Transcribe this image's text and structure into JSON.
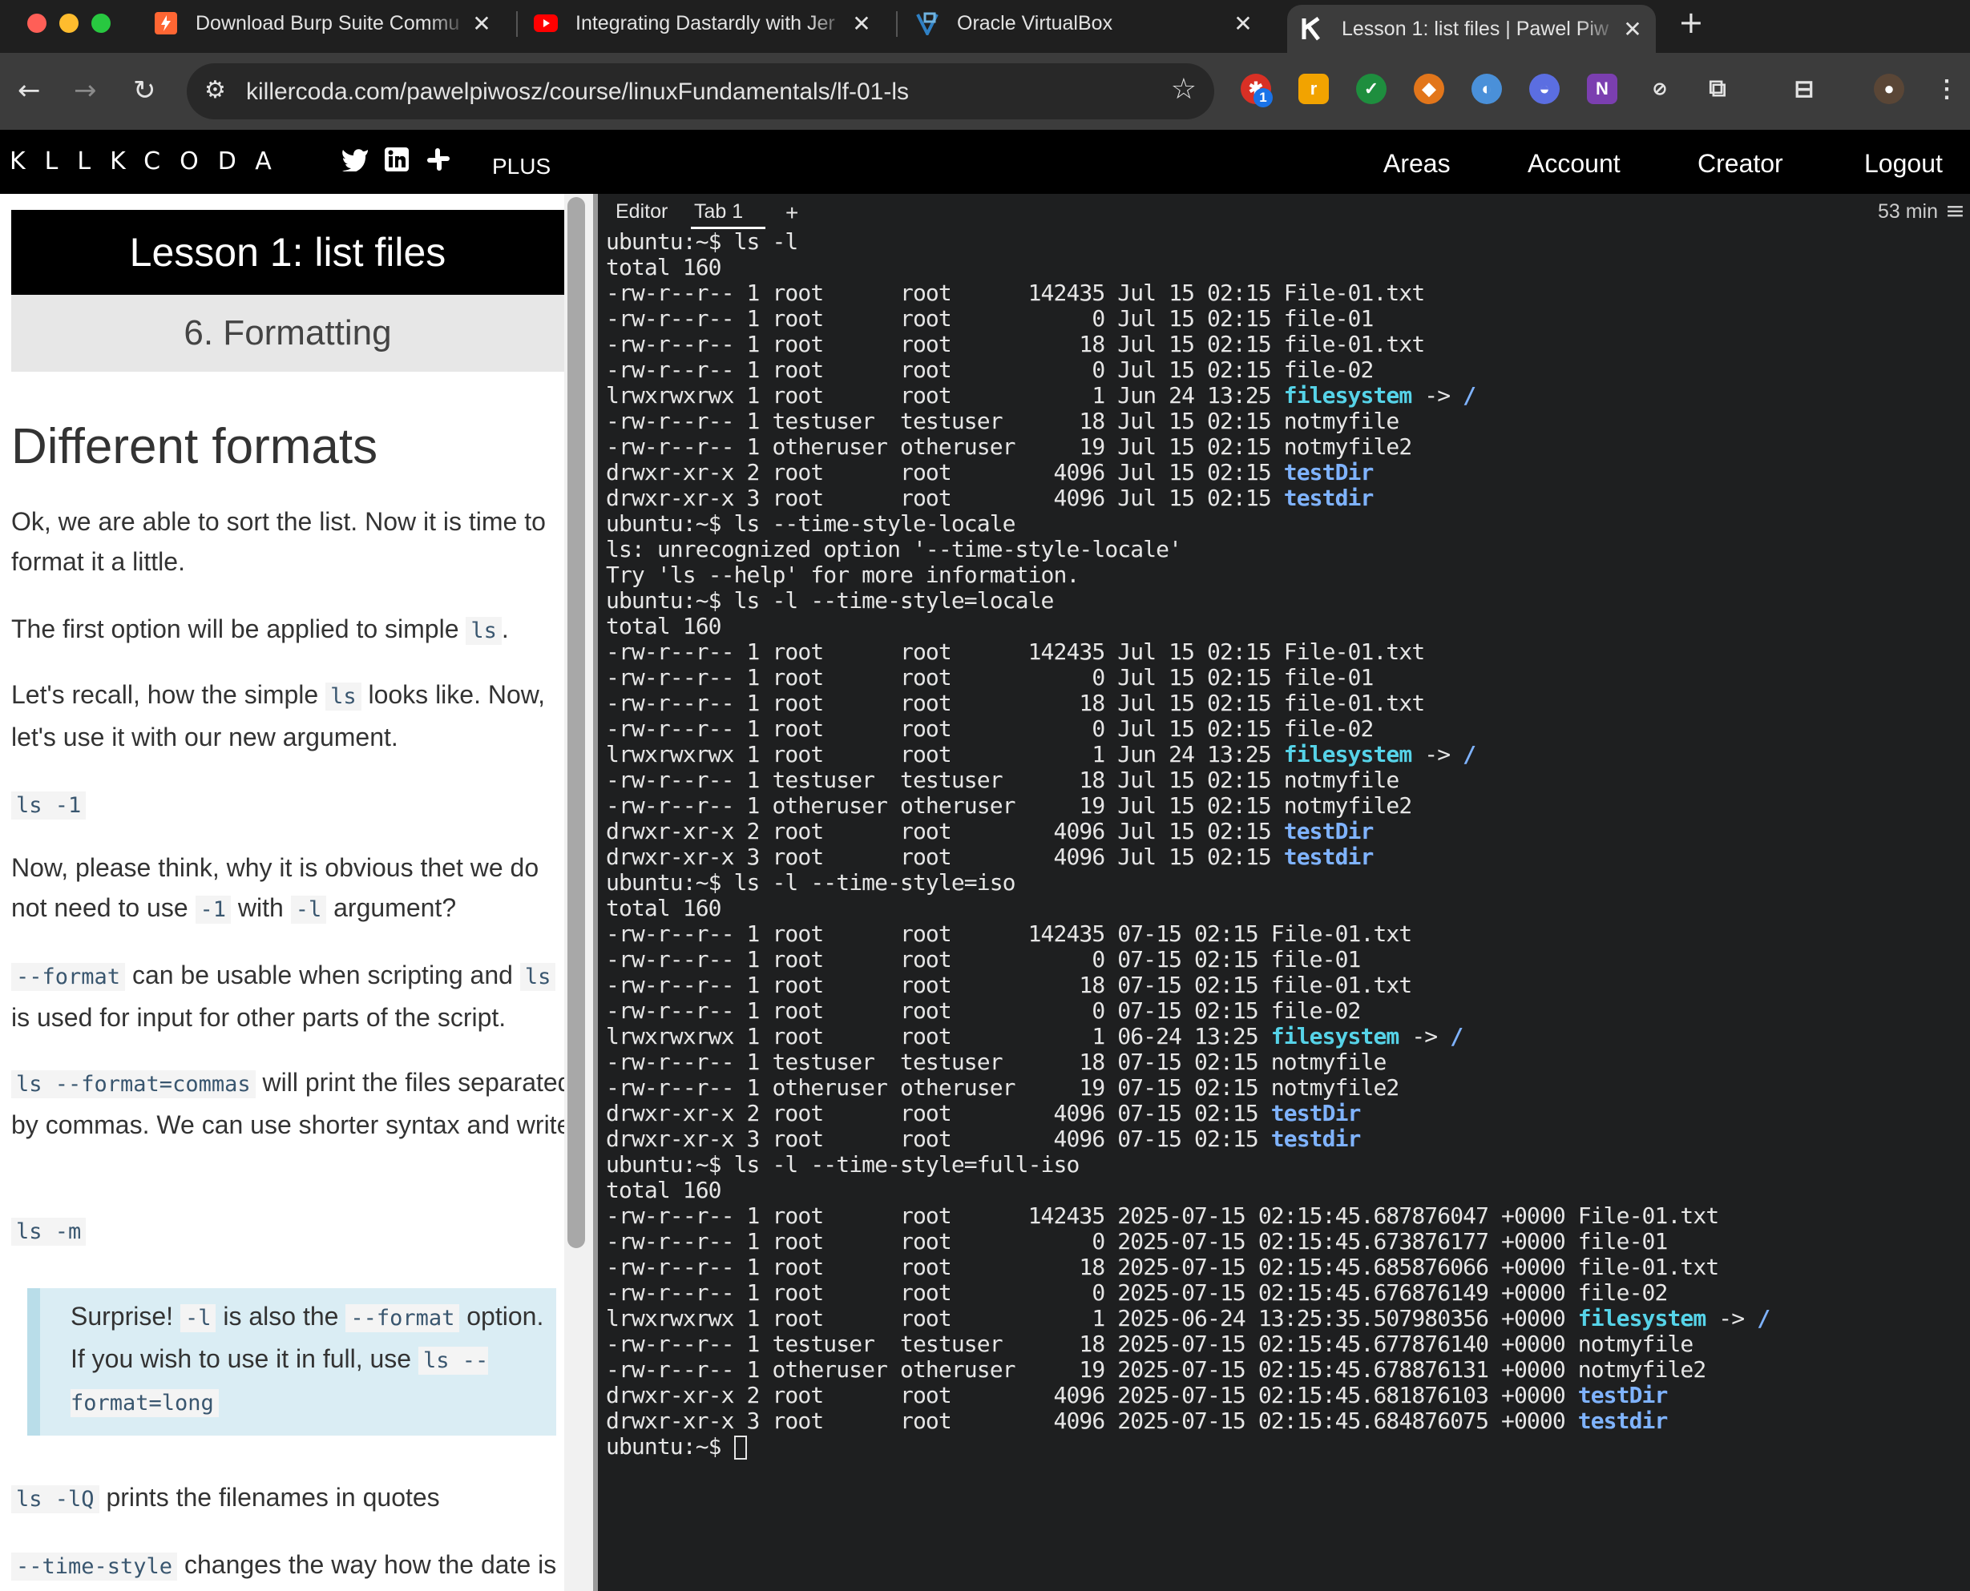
{
  "browser": {
    "tabs": [
      {
        "title": "Download Burp Suite Commu",
        "icon": "burp-icon",
        "color": "#ff6633"
      },
      {
        "title": "Integrating Dastardly with Jer",
        "icon": "youtube-icon",
        "color": "#ff0000"
      },
      {
        "title": "Oracle VirtualBox",
        "icon": "virtualbox-icon",
        "color": "#2f80c4"
      },
      {
        "title": "Lesson 1: list files | Pawel Piw",
        "icon": "killercoda-icon",
        "color": "#ffffff"
      }
    ],
    "url": "killercoda.com/pawelpiwosz/course/linuxFundamentals/lf-01-ls",
    "extension_badge": "1"
  },
  "site": {
    "logo": "KLLKCODA",
    "plus": "PLUS",
    "nav": [
      "Areas",
      "Account",
      "Creator",
      "Logout"
    ]
  },
  "lesson": {
    "title": "Lesson 1: list files",
    "step": "6. Formatting",
    "heading": "Different formats",
    "p1": "Ok, we are able to sort the list. Now it is time to format it a little.",
    "p2_pre": "The first option will be applied to simple ",
    "p2_code": "ls",
    "p2_post": ".",
    "p3_pre": "Let's recall, how the simple ",
    "p3_code": "ls",
    "p3_post": " looks like. Now, let's use it with our new argument.",
    "code1": "ls -1",
    "p4_pre": "Now, please think, why it is obvious thet we do not need to use ",
    "p4_code1": "-1",
    "p4_mid": " with ",
    "p4_code2": "-l",
    "p4_post": " argument?",
    "p5_code1": "--format",
    "p5_mid": " can be usable when scripting and ",
    "p5_code2": "ls",
    "p5_post": " is used for input for other parts of the script.",
    "p6_code": "ls --format=commas",
    "p6_post": " will print the files separated by commas. We can use shorter syntax and write",
    "code2": "ls -m",
    "callout_pre": "Surprise! ",
    "callout_code1": "-l",
    "callout_mid": " is also the ",
    "callout_code2": "--format",
    "callout_mid2": " option. If you wish to use it in full, use ",
    "callout_code3": "ls --format=long",
    "p7_code": "ls -lQ",
    "p7_post": " prints the filenames in quotes",
    "p8_code": "--time-style",
    "p8_post": " changes the way how the date is"
  },
  "terminal": {
    "tabs": [
      "Editor",
      "Tab 1",
      "+"
    ],
    "timer": "53 min",
    "prompt": "ubuntu:~$ ",
    "lines": [
      [
        {
          "t": "ubuntu:~$ ls -l"
        }
      ],
      [
        {
          "t": "total 160"
        }
      ],
      [
        {
          "t": "-rw-r--r-- 1 root      root      142435 Jul 15 02:15 File-01.txt"
        }
      ],
      [
        {
          "t": "-rw-r--r-- 1 root      root           0 Jul 15 02:15 file-01"
        }
      ],
      [
        {
          "t": "-rw-r--r-- 1 root      root          18 Jul 15 02:15 file-01.txt"
        }
      ],
      [
        {
          "t": "-rw-r--r-- 1 root      root           0 Jul 15 02:15 file-02"
        }
      ],
      [
        {
          "t": "lrwxrwxrwx 1 root      root           1 Jun 24 13:25 "
        },
        {
          "t": "filesystem",
          "c": "cyan"
        },
        {
          "t": " -> "
        },
        {
          "t": "/",
          "c": "blue"
        }
      ],
      [
        {
          "t": "-rw-r--r-- 1 testuser  testuser      18 Jul 15 02:15 notmyfile"
        }
      ],
      [
        {
          "t": "-rw-r--r-- 1 otheruser otheruser     19 Jul 15 02:15 notmyfile2"
        }
      ],
      [
        {
          "t": "drwxr-xr-x 2 root      root        4096 Jul 15 02:15 "
        },
        {
          "t": "testDir",
          "c": "blue"
        }
      ],
      [
        {
          "t": "drwxr-xr-x 3 root      root        4096 Jul 15 02:15 "
        },
        {
          "t": "testdir",
          "c": "blue"
        }
      ],
      [
        {
          "t": "ubuntu:~$ ls --time-style-locale"
        }
      ],
      [
        {
          "t": "ls: unrecognized option '--time-style-locale'"
        }
      ],
      [
        {
          "t": "Try 'ls --help' for more information."
        }
      ],
      [
        {
          "t": "ubuntu:~$ ls -l --time-style=locale"
        }
      ],
      [
        {
          "t": "total 160"
        }
      ],
      [
        {
          "t": "-rw-r--r-- 1 root      root      142435 Jul 15 02:15 File-01.txt"
        }
      ],
      [
        {
          "t": "-rw-r--r-- 1 root      root           0 Jul 15 02:15 file-01"
        }
      ],
      [
        {
          "t": "-rw-r--r-- 1 root      root          18 Jul 15 02:15 file-01.txt"
        }
      ],
      [
        {
          "t": "-rw-r--r-- 1 root      root           0 Jul 15 02:15 file-02"
        }
      ],
      [
        {
          "t": "lrwxrwxrwx 1 root      root           1 Jun 24 13:25 "
        },
        {
          "t": "filesystem",
          "c": "cyan"
        },
        {
          "t": " -> "
        },
        {
          "t": "/",
          "c": "blue"
        }
      ],
      [
        {
          "t": "-rw-r--r-- 1 testuser  testuser      18 Jul 15 02:15 notmyfile"
        }
      ],
      [
        {
          "t": "-rw-r--r-- 1 otheruser otheruser     19 Jul 15 02:15 notmyfile2"
        }
      ],
      [
        {
          "t": "drwxr-xr-x 2 root      root        4096 Jul 15 02:15 "
        },
        {
          "t": "testDir",
          "c": "blue"
        }
      ],
      [
        {
          "t": "drwxr-xr-x 3 root      root        4096 Jul 15 02:15 "
        },
        {
          "t": "testdir",
          "c": "blue"
        }
      ],
      [
        {
          "t": "ubuntu:~$ ls -l --time-style=iso"
        }
      ],
      [
        {
          "t": "total 160"
        }
      ],
      [
        {
          "t": "-rw-r--r-- 1 root      root      142435 07-15 02:15 File-01.txt"
        }
      ],
      [
        {
          "t": "-rw-r--r-- 1 root      root           0 07-15 02:15 file-01"
        }
      ],
      [
        {
          "t": "-rw-r--r-- 1 root      root          18 07-15 02:15 file-01.txt"
        }
      ],
      [
        {
          "t": "-rw-r--r-- 1 root      root           0 07-15 02:15 file-02"
        }
      ],
      [
        {
          "t": "lrwxrwxrwx 1 root      root           1 06-24 13:25 "
        },
        {
          "t": "filesystem",
          "c": "cyan"
        },
        {
          "t": " -> "
        },
        {
          "t": "/",
          "c": "blue"
        }
      ],
      [
        {
          "t": "-rw-r--r-- 1 testuser  testuser      18 07-15 02:15 notmyfile"
        }
      ],
      [
        {
          "t": "-rw-r--r-- 1 otheruser otheruser     19 07-15 02:15 notmyfile2"
        }
      ],
      [
        {
          "t": "drwxr-xr-x 2 root      root        4096 07-15 02:15 "
        },
        {
          "t": "testDir",
          "c": "blue"
        }
      ],
      [
        {
          "t": "drwxr-xr-x 3 root      root        4096 07-15 02:15 "
        },
        {
          "t": "testdir",
          "c": "blue"
        }
      ],
      [
        {
          "t": "ubuntu:~$ ls -l --time-style=full-iso"
        }
      ],
      [
        {
          "t": "total 160"
        }
      ],
      [
        {
          "t": "-rw-r--r-- 1 root      root      142435 2025-07-15 02:15:45.687876047 +0000 File-01.txt"
        }
      ],
      [
        {
          "t": "-rw-r--r-- 1 root      root           0 2025-07-15 02:15:45.673876177 +0000 file-01"
        }
      ],
      [
        {
          "t": "-rw-r--r-- 1 root      root          18 2025-07-15 02:15:45.685876066 +0000 file-01.txt"
        }
      ],
      [
        {
          "t": "-rw-r--r-- 1 root      root           0 2025-07-15 02:15:45.676876149 +0000 file-02"
        }
      ],
      [
        {
          "t": "lrwxrwxrwx 1 root      root           1 2025-06-24 13:25:35.507980356 +0000 "
        },
        {
          "t": "filesystem",
          "c": "cyan"
        },
        {
          "t": " -> "
        },
        {
          "t": "/",
          "c": "blue"
        }
      ],
      [
        {
          "t": "-rw-r--r-- 1 testuser  testuser      18 2025-07-15 02:15:45.677876140 +0000 notmyfile"
        }
      ],
      [
        {
          "t": "-rw-r--r-- 1 otheruser otheruser     19 2025-07-15 02:15:45.678876131 +0000 notmyfile2"
        }
      ],
      [
        {
          "t": "drwxr-xr-x 2 root      root        4096 2025-07-15 02:15:45.681876103 +0000 "
        },
        {
          "t": "testDir",
          "c": "blue"
        }
      ],
      [
        {
          "t": "drwxr-xr-x 3 root      root        4096 2025-07-15 02:15:45.684876075 +0000 "
        },
        {
          "t": "testdir",
          "c": "blue"
        }
      ]
    ]
  },
  "colors": {
    "terminal_bg": "#1e1f20",
    "symlink": "#56d3e8",
    "directory": "#7fb3ff"
  }
}
